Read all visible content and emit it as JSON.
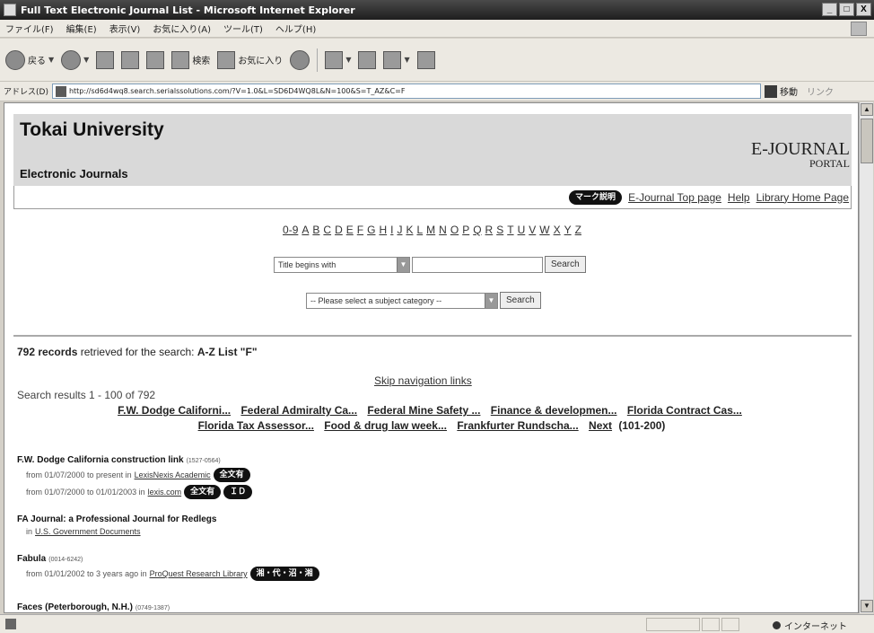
{
  "window": {
    "title": "Full Text Electronic Journal List - Microsoft Internet Explorer",
    "buttons": [
      "_",
      "□",
      "X"
    ]
  },
  "menubar": [
    "ファイル(F)",
    "編集(E)",
    "表示(V)",
    "お気に入り(A)",
    "ツール(T)",
    "ヘルプ(H)"
  ],
  "toolbar": {
    "back": "戻る",
    "search": "検索",
    "favorites": "お気に入り"
  },
  "addressbar": {
    "label": "アドレス(D)",
    "url": "http://sd6d4wq8.search.serialssolutions.com/?V=1.0&L=SD6D4WQ8L&N=100&S=T_AZ&C=F",
    "go": "移動",
    "links": "リンク"
  },
  "page": {
    "university": "Tokai University",
    "subtitle": "Electronic Journals",
    "logo_line1": "E-JOURNAL",
    "logo_line2": "PORTAL",
    "nav_badge": "マーク説明",
    "nav_links": [
      "E-Journal Top page",
      "Help",
      "Library Home Page"
    ],
    "az_letters": [
      "0-9",
      "A",
      "B",
      "C",
      "D",
      "E",
      "F",
      "G",
      "H",
      "I",
      "J",
      "K",
      "L",
      "M",
      "N",
      "O",
      "P",
      "Q",
      "R",
      "S",
      "T",
      "U",
      "V",
      "W",
      "X",
      "Y",
      "Z"
    ],
    "title_select": "Title begins with",
    "search_button": "Search",
    "subject_select": "-- Please select a subject category --",
    "search_button2": "Search",
    "records_count": "792 records",
    "records_text": "retrieved for the search:",
    "records_query": "A-Z List \"F\"",
    "skip_link": "Skip navigation links",
    "results_text": "Search results 1 - 100 of 792",
    "journal_nav": [
      "F.W. Dodge Californi...",
      "Federal Admiralty Ca...",
      "Federal Mine Safety ...",
      "Finance & developmen...",
      "Florida Contract Cas...",
      "Florida Tax Assessor...",
      "Food & drug law week...",
      "Frankfurter Rundscha..."
    ],
    "next_link": "Next",
    "next_range": "(101-200)"
  },
  "entries": [
    {
      "title": "F.W. Dodge California construction link",
      "issn": "(1527-0564)",
      "lines": [
        {
          "text": "from 01/07/2000 to present in",
          "source": "LexisNexis Academic",
          "badges": [
            "全文有"
          ]
        },
        {
          "text": "from 01/07/2000 to 01/01/2003 in",
          "source": "lexis.com",
          "badges": [
            "全文有",
            "ＩＤ"
          ]
        }
      ]
    },
    {
      "title": "FA Journal: a Professional Journal for Redlegs",
      "issn": "",
      "lines": [
        {
          "text": "in",
          "source": "U.S. Government Documents",
          "badges": []
        }
      ]
    },
    {
      "title": "Fabula",
      "issn": "(0014-6242)",
      "lines": [
        {
          "text": "from 01/01/2002 to 3 years ago in",
          "source": "ProQuest Research Library",
          "badges": [
            "湘・代・沼・湘"
          ]
        }
      ]
    },
    {
      "title": "Faces (Peterborough, N.H.)",
      "issn": "(0749-1387)",
      "lines": []
    }
  ],
  "status": {
    "zone": "インターネット"
  }
}
